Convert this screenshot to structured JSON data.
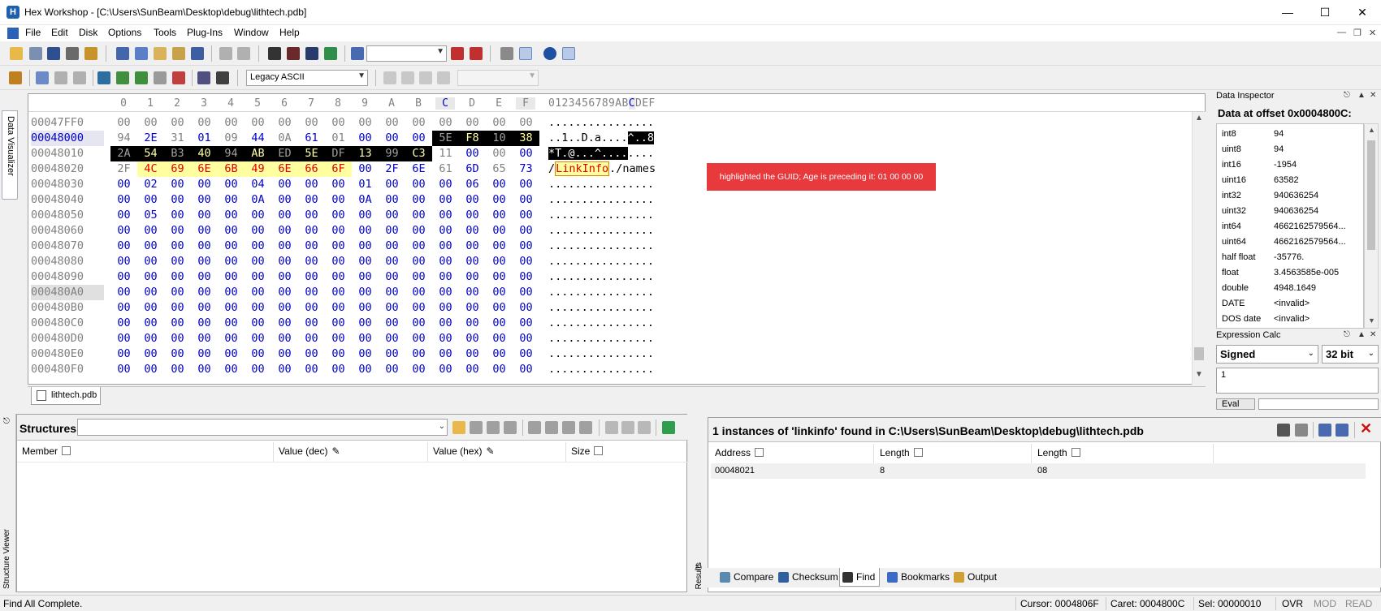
{
  "window": {
    "title": "Hex Workshop - [C:\\Users\\SunBeam\\Desktop\\debug\\lithtech.pdb]",
    "app_icon": "hex-workshop-icon",
    "controls": [
      "minimize-icon",
      "maximize-icon",
      "close-icon"
    ]
  },
  "menubar": {
    "items": [
      "File",
      "Edit",
      "Disk",
      "Options",
      "Tools",
      "Plug-Ins",
      "Window",
      "Help"
    ]
  },
  "toolbar": {
    "combo_legacy": "Legacy ASCII",
    "combo_empty": ""
  },
  "data_visualizer_tab": "Data Visualizer",
  "hex": {
    "column_headers": [
      "0",
      "1",
      "2",
      "3",
      "4",
      "5",
      "6",
      "7",
      "8",
      "9",
      "A",
      "B",
      "C",
      "D",
      "E",
      "F"
    ],
    "ascii_header_pre": "0123456789AB",
    "ascii_header_sel": "C",
    "ascii_header_post": "DEF",
    "rows": [
      {
        "addr": "00047FF0",
        "bytes": [
          "00",
          "00",
          "00",
          "00",
          "00",
          "00",
          "00",
          "00",
          "00",
          "00",
          "00",
          "00",
          "00",
          "00",
          "00",
          "00"
        ],
        "ascii": "................"
      },
      {
        "addr": "00048000",
        "bytes": [
          "94",
          "2E",
          "31",
          "01",
          "09",
          "44",
          "0A",
          "61",
          "01",
          "00",
          "00",
          "00",
          "5E",
          "F8",
          "10",
          "38"
        ],
        "ascii_pre": "..1..D.a....",
        "ascii_sel": "^..8",
        "ascii_post": ""
      },
      {
        "addr": "00048010",
        "bytes": [
          "2A",
          "54",
          "B3",
          "40",
          "94",
          "AB",
          "ED",
          "5E",
          "DF",
          "13",
          "99",
          "C3",
          "11",
          "00",
          "00",
          "00"
        ],
        "ascii_pre": "",
        "ascii_sel": "*T.@...^....",
        "ascii_post": "...."
      },
      {
        "addr": "00048020",
        "bytes": [
          "2F",
          "4C",
          "69",
          "6E",
          "6B",
          "49",
          "6E",
          "66",
          "6F",
          "00",
          "2F",
          "6E",
          "61",
          "6D",
          "65",
          "73"
        ],
        "ascii_pre": "/",
        "ascii_sel": "LinkInfo",
        "ascii_post": "./names"
      },
      {
        "addr": "00048030",
        "bytes": [
          "00",
          "02",
          "00",
          "00",
          "00",
          "04",
          "00",
          "00",
          "00",
          "01",
          "00",
          "00",
          "00",
          "06",
          "00",
          "00"
        ],
        "ascii": "................"
      },
      {
        "addr": "00048040",
        "bytes": [
          "00",
          "00",
          "00",
          "00",
          "00",
          "0A",
          "00",
          "00",
          "00",
          "0A",
          "00",
          "00",
          "00",
          "00",
          "00",
          "00"
        ],
        "ascii": "................"
      },
      {
        "addr": "00048050",
        "bytes": [
          "00",
          "05",
          "00",
          "00",
          "00",
          "00",
          "00",
          "00",
          "00",
          "00",
          "00",
          "00",
          "00",
          "00",
          "00",
          "00"
        ],
        "ascii": "................"
      },
      {
        "addr": "00048060",
        "bytes": [
          "00",
          "00",
          "00",
          "00",
          "00",
          "00",
          "00",
          "00",
          "00",
          "00",
          "00",
          "00",
          "00",
          "00",
          "00",
          "00"
        ],
        "ascii": "................"
      },
      {
        "addr": "00048070",
        "bytes": [
          "00",
          "00",
          "00",
          "00",
          "00",
          "00",
          "00",
          "00",
          "00",
          "00",
          "00",
          "00",
          "00",
          "00",
          "00",
          "00"
        ],
        "ascii": "................"
      },
      {
        "addr": "00048080",
        "bytes": [
          "00",
          "00",
          "00",
          "00",
          "00",
          "00",
          "00",
          "00",
          "00",
          "00",
          "00",
          "00",
          "00",
          "00",
          "00",
          "00"
        ],
        "ascii": "................"
      },
      {
        "addr": "00048090",
        "bytes": [
          "00",
          "00",
          "00",
          "00",
          "00",
          "00",
          "00",
          "00",
          "00",
          "00",
          "00",
          "00",
          "00",
          "00",
          "00",
          "00"
        ],
        "ascii": "................"
      },
      {
        "addr": "000480A0",
        "bytes": [
          "00",
          "00",
          "00",
          "00",
          "00",
          "00",
          "00",
          "00",
          "00",
          "00",
          "00",
          "00",
          "00",
          "00",
          "00",
          "00"
        ],
        "ascii": "................"
      },
      {
        "addr": "000480B0",
        "bytes": [
          "00",
          "00",
          "00",
          "00",
          "00",
          "00",
          "00",
          "00",
          "00",
          "00",
          "00",
          "00",
          "00",
          "00",
          "00",
          "00"
        ],
        "ascii": "................"
      },
      {
        "addr": "000480C0",
        "bytes": [
          "00",
          "00",
          "00",
          "00",
          "00",
          "00",
          "00",
          "00",
          "00",
          "00",
          "00",
          "00",
          "00",
          "00",
          "00",
          "00"
        ],
        "ascii": "................"
      },
      {
        "addr": "000480D0",
        "bytes": [
          "00",
          "00",
          "00",
          "00",
          "00",
          "00",
          "00",
          "00",
          "00",
          "00",
          "00",
          "00",
          "00",
          "00",
          "00",
          "00"
        ],
        "ascii": "................"
      },
      {
        "addr": "000480E0",
        "bytes": [
          "00",
          "00",
          "00",
          "00",
          "00",
          "00",
          "00",
          "00",
          "00",
          "00",
          "00",
          "00",
          "00",
          "00",
          "00",
          "00"
        ],
        "ascii": "................"
      },
      {
        "addr": "000480F0",
        "bytes": [
          "00",
          "00",
          "00",
          "00",
          "00",
          "00",
          "00",
          "00",
          "00",
          "00",
          "00",
          "00",
          "00",
          "00",
          "00",
          "00"
        ],
        "ascii": "................"
      }
    ],
    "annotation": "highlighted the GUID; Age is preceding it: 01 00 00 00"
  },
  "document_tab": "lithtech.pdb",
  "data_inspector": {
    "title": "Data Inspector",
    "subtitle": "Data at offset 0x0004800C:",
    "rows": [
      {
        "k": "int8",
        "v": "94"
      },
      {
        "k": "uint8",
        "v": "94"
      },
      {
        "k": "int16",
        "v": "-1954"
      },
      {
        "k": "uint16",
        "v": "63582"
      },
      {
        "k": "int32",
        "v": "940636254"
      },
      {
        "k": "uint32",
        "v": "940636254"
      },
      {
        "k": "int64",
        "v": "4662162579564..."
      },
      {
        "k": "uint64",
        "v": "4662162579564..."
      },
      {
        "k": "half float",
        "v": "-35776."
      },
      {
        "k": "float",
        "v": "3.4563585e-005"
      },
      {
        "k": "double",
        "v": "4948.1649"
      },
      {
        "k": "DATE",
        "v": "<invalid>"
      },
      {
        "k": "DOS date",
        "v": "<invalid>"
      }
    ]
  },
  "expression_calc": {
    "title": "Expression Calc",
    "sign_mode": "Signed",
    "bits": "32 bit",
    "input": "1",
    "eval_label": "Eval"
  },
  "structures": {
    "title": "Structures",
    "side_label": "Structure Viewer",
    "columns": [
      "Member",
      "Value (dec)",
      "Value (hex)",
      "Size"
    ]
  },
  "results": {
    "side_label": "Results",
    "title": "1 instances of 'linkinfo' found in C:\\Users\\SunBeam\\Desktop\\debug\\lithtech.pdb",
    "columns": [
      "Address",
      "Length",
      "Length"
    ],
    "rows": [
      {
        "address": "00048021",
        "length": "8",
        "length_hex": "08"
      }
    ],
    "tabs": [
      "Compare",
      "Checksum",
      "Find",
      "Bookmarks",
      "Output"
    ],
    "active_tab": "Find"
  },
  "statusbar": {
    "message": "Find All Complete.",
    "cursor": "Cursor: 0004806F",
    "caret": "Caret: 0004800C",
    "sel": "Sel: 00000010",
    "ovr": "OVR",
    "mod": "MOD",
    "read": "READ"
  },
  "colors": {
    "accent_blue": "#0000c8",
    "selection_bg": "#000000",
    "find_highlight": "#ffffa0",
    "callout_red": "#e8393c"
  }
}
